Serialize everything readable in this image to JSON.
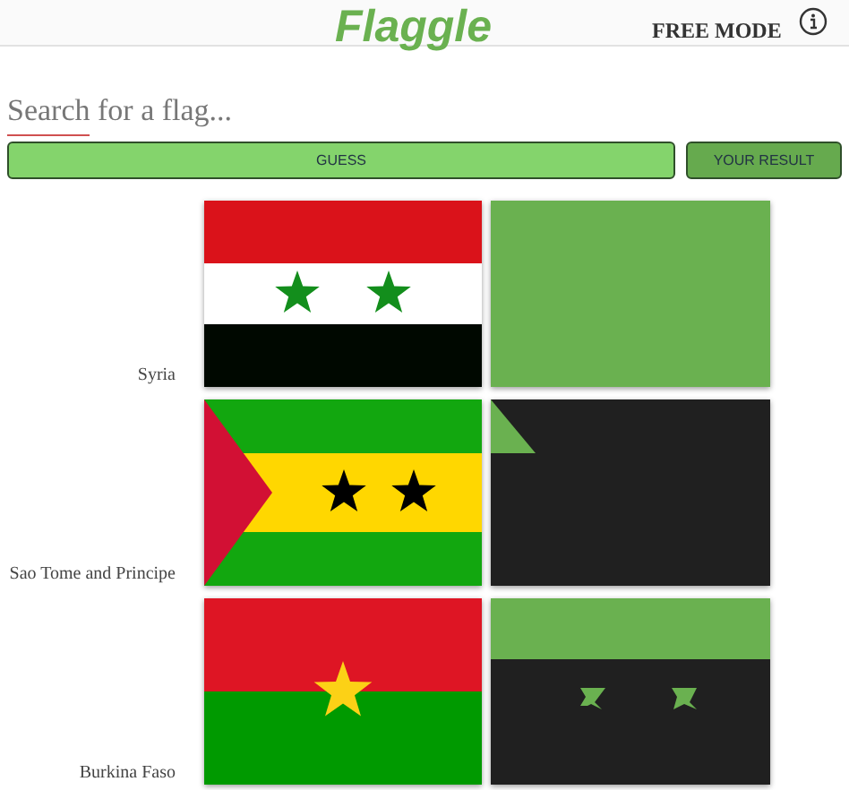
{
  "header": {
    "logo": "Flaggle",
    "mode": "FREE MODE"
  },
  "search": {
    "placeholder": "Search for a flag..."
  },
  "buttons": {
    "guess": "GUESS",
    "result": "YOUR RESULT"
  },
  "guesses": [
    {
      "name": "Syria",
      "kind": "syria"
    },
    {
      "name": "Sao Tome and Principe",
      "kind": "sao-tome"
    },
    {
      "name": "Burkina Faso",
      "kind": "burkina"
    }
  ]
}
